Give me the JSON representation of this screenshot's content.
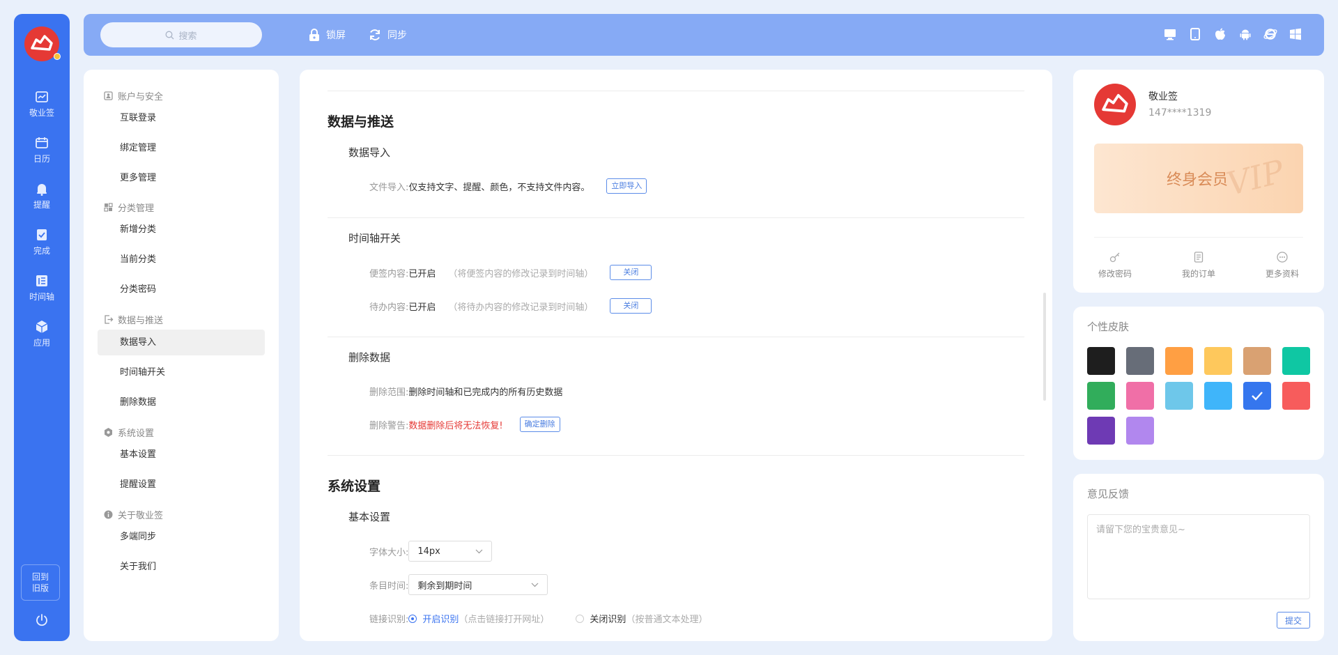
{
  "rail": {
    "items": [
      {
        "label": "敬业签",
        "icon": "note-icon"
      },
      {
        "label": "日历",
        "icon": "calendar-icon"
      },
      {
        "label": "提醒",
        "icon": "bell-icon"
      },
      {
        "label": "完成",
        "icon": "done-icon"
      },
      {
        "label": "时间轴",
        "icon": "timeline-icon"
      },
      {
        "label": "应用",
        "icon": "cube-icon"
      }
    ],
    "old_version_line1": "回到",
    "old_version_line2": "旧版"
  },
  "topbar": {
    "search_placeholder": "搜索",
    "lock_label": "锁屏",
    "sync_label": "同步",
    "platforms": [
      "desktop-icon",
      "tablet-icon",
      "apple-icon",
      "android-icon",
      "ie-icon",
      "windows-icon"
    ]
  },
  "nav": {
    "groups": [
      {
        "title": "账户与安全",
        "items": [
          "互联登录",
          "绑定管理",
          "更多管理"
        ]
      },
      {
        "title": "分类管理",
        "items": [
          "新增分类",
          "当前分类",
          "分类密码"
        ]
      },
      {
        "title": "数据与推送",
        "items": [
          "数据导入",
          "时间轴开关",
          "删除数据"
        ]
      },
      {
        "title": "系统设置",
        "items": [
          "基本设置",
          "提醒设置"
        ]
      },
      {
        "title": "关于敬业签",
        "items": [
          "多端同步",
          "关于我们"
        ]
      }
    ],
    "active": "数据导入"
  },
  "main": {
    "data_section": {
      "title": "数据与推送",
      "import": {
        "title": "数据导入",
        "label": "文件导入:",
        "value": "仅支持文字、提醒、颜色，不支持文件内容。",
        "button": "立即导入"
      },
      "timeline": {
        "title": "时间轴开关",
        "rows": [
          {
            "label": "便签内容:",
            "value": "已开启",
            "hint": "（将便签内容的修改记录到时间轴）",
            "button": "关闭"
          },
          {
            "label": "待办内容:",
            "value": "已开启",
            "hint": "（将待办内容的修改记录到时间轴）",
            "button": "关闭"
          }
        ]
      },
      "delete": {
        "title": "删除数据",
        "range_label": "删除范围:",
        "range_value": "删除时间轴和已完成内的所有历史数据",
        "warn_label": "删除警告:",
        "warn_value": "数据删除后将无法恢复!",
        "button": "确定删除"
      }
    },
    "system_section": {
      "title": "系统设置",
      "basic": {
        "title": "基本设置",
        "font_label": "字体大小:",
        "font_value": "14px",
        "time_label": "条目时间:",
        "time_value": "剩余到期时间",
        "link_label": "链接识别:",
        "link_on": "开启识别",
        "link_on_hint": "（点击链接打开网址）",
        "link_off": "关闭识别",
        "link_off_hint": "（按普通文本处理）"
      }
    }
  },
  "profile": {
    "name": "敬业签",
    "phone": "147****1319",
    "vip_label": "终身会员",
    "vip_watermark": "VIP",
    "actions": [
      {
        "label": "修改密码",
        "icon": "key-icon"
      },
      {
        "label": "我的订单",
        "icon": "order-icon"
      },
      {
        "label": "更多资料",
        "icon": "more-icon"
      }
    ]
  },
  "skin": {
    "title": "个性皮肤",
    "colors": [
      "#1e1e1e",
      "#676d78",
      "#ff9f43",
      "#fec85c",
      "#d9a172",
      "#0fc7a3",
      "#31ad5b",
      "#f06fa7",
      "#6ec7ea",
      "#3fb5fa",
      "#3576ee",
      "#f75c5c",
      "#6e3ab4",
      "#b187ee"
    ],
    "selected_index": 10
  },
  "feedback": {
    "title": "意见反馈",
    "placeholder": "请留下您的宝贵意见~",
    "submit": "提交"
  }
}
